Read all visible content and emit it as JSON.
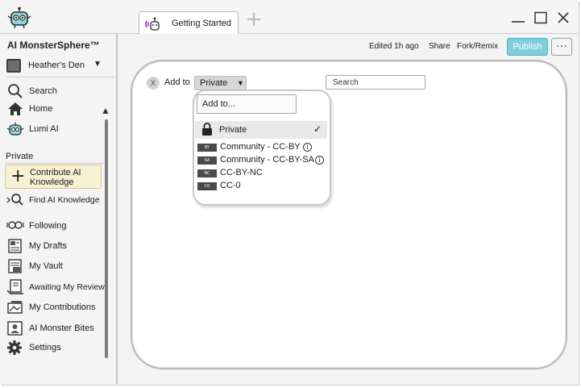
{
  "window": {
    "tab_label": "Getting Started",
    "tab_icon": "robot-mascot-icon",
    "add_tab_icon": "plus-icon",
    "controls": [
      "minimize-icon",
      "maximize-icon",
      "close-icon"
    ]
  },
  "sidebar": {
    "app_title": "AI MonsterSphere™",
    "workspace": "Heather's Den",
    "nav": [
      {
        "label": "Search",
        "icon": "search-icon"
      },
      {
        "label": "Home",
        "icon": "home-icon"
      },
      {
        "label": "Lumi AI",
        "icon": "robot-icon"
      }
    ],
    "section_private": "Private",
    "contribute_label": "Contribute AI Knowledge",
    "private_items": [
      {
        "label": "Find AI Knowledge",
        "icon": "find-knowledge-icon"
      },
      {
        "label": "Following",
        "icon": "following-icon"
      },
      {
        "label": "My Drafts",
        "icon": "drafts-icon"
      },
      {
        "label": "My Vault",
        "icon": "vault-icon"
      },
      {
        "label": "Awaiting My Review",
        "icon": "review-icon"
      },
      {
        "label": "My Contributions",
        "icon": "contributions-icon"
      },
      {
        "label": "AI Monster Bites",
        "icon": "bites-icon"
      },
      {
        "label": "Settings",
        "icon": "gear-icon"
      }
    ]
  },
  "header": {
    "edited": "Edited 1h ago",
    "share": "Share",
    "fork": "Fork/Remix",
    "publish": "Publish",
    "more": "···",
    "accent_color": "#7fcfdb"
  },
  "toolbar": {
    "add_to_label": "Add to",
    "clear": "X",
    "privacy_value": "Private",
    "search_placeholder": "Search"
  },
  "dropdown": {
    "input_placeholder": "Add to...",
    "selected": "Private",
    "check": "✓",
    "options": [
      {
        "badge": "BY",
        "label": "Community - CC-BY",
        "info": "i"
      },
      {
        "badge": "SA",
        "label": "Community - CC-BY-SA",
        "info": "i"
      },
      {
        "badge": "NC",
        "label": "CC-BY-NC"
      },
      {
        "badge": "C0",
        "label": "CC-0"
      }
    ]
  }
}
